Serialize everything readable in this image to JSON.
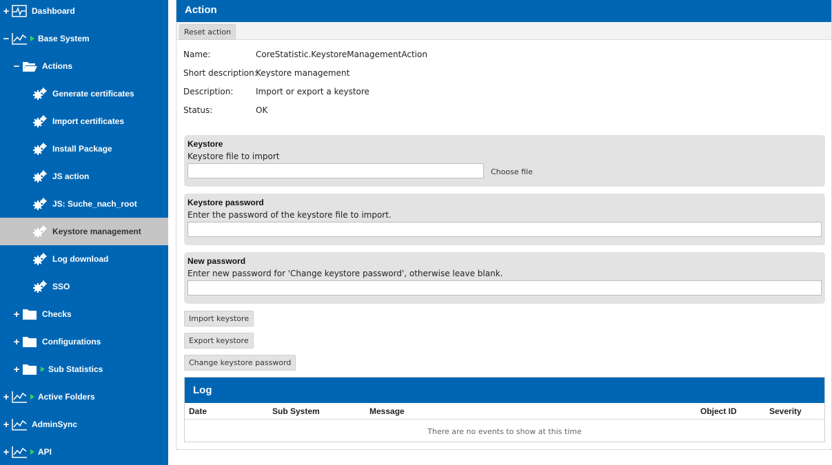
{
  "sidebar": {
    "items": [
      {
        "label": "Dashboard",
        "toggle": "+",
        "icon": "heartbeat-monitor-icon"
      },
      {
        "label": "Base System",
        "toggle": "−",
        "icon": "line-chart-icon"
      },
      {
        "label": "Actions",
        "toggle": "−",
        "icon": "folder-open-icon"
      },
      {
        "label": "Generate certificates",
        "icon": "gears-icon"
      },
      {
        "label": "Import certificates",
        "icon": "gears-icon"
      },
      {
        "label": "Install Package",
        "icon": "gears-icon"
      },
      {
        "label": "JS action",
        "icon": "gears-icon"
      },
      {
        "label": "JS: Suche_nach_root",
        "icon": "gears-icon"
      },
      {
        "label": "Keystore management",
        "icon": "gears-icon",
        "selected": true
      },
      {
        "label": "Log download",
        "icon": "gears-icon"
      },
      {
        "label": "SSO",
        "icon": "gears-icon"
      },
      {
        "label": "Checks",
        "toggle": "+",
        "icon": "folder-icon"
      },
      {
        "label": "Configurations",
        "toggle": "+",
        "icon": "folder-icon"
      },
      {
        "label": "Sub Statistics",
        "toggle": "+",
        "icon": "folder-icon"
      },
      {
        "label": "Active Folders",
        "toggle": "+",
        "icon": "line-chart-icon"
      },
      {
        "label": "AdminSync",
        "toggle": "+",
        "icon": "line-chart-icon"
      },
      {
        "label": "API",
        "toggle": "+",
        "icon": "line-chart-icon"
      }
    ]
  },
  "panel": {
    "title": "Action",
    "reset_label": "Reset action"
  },
  "info": {
    "name_key": "Name:",
    "name_val": "CoreStatistic.KeystoreManagementAction",
    "short_key": "Short description:",
    "short_val": "Keystore management",
    "desc_key": "Description:",
    "desc_val": "Import or export a keystore",
    "status_key": "Status:",
    "status_val": "OK"
  },
  "keystore": {
    "title": "Keystore",
    "desc": "Keystore file to import",
    "file_value": "",
    "choose_label": "Choose file"
  },
  "keystore_password": {
    "title": "Keystore password",
    "desc": "Enter the password of the keystore file to import.",
    "value": ""
  },
  "new_password": {
    "title": "New password",
    "desc": "Enter new password for 'Change keystore password', otherwise leave blank.",
    "value": ""
  },
  "actions": {
    "import_label": "Import keystore",
    "export_label": "Export keystore",
    "change_label": "Change keystore password"
  },
  "log": {
    "title": "Log",
    "columns": [
      "Date",
      "Sub System",
      "Message",
      "Object ID",
      "Severity"
    ],
    "empty_text": "There are no events to show at this time"
  },
  "colors": {
    "brand_blue": "#0066b3",
    "selected_bg": "#c5c5c5",
    "arrow_green": "#33d15c"
  }
}
